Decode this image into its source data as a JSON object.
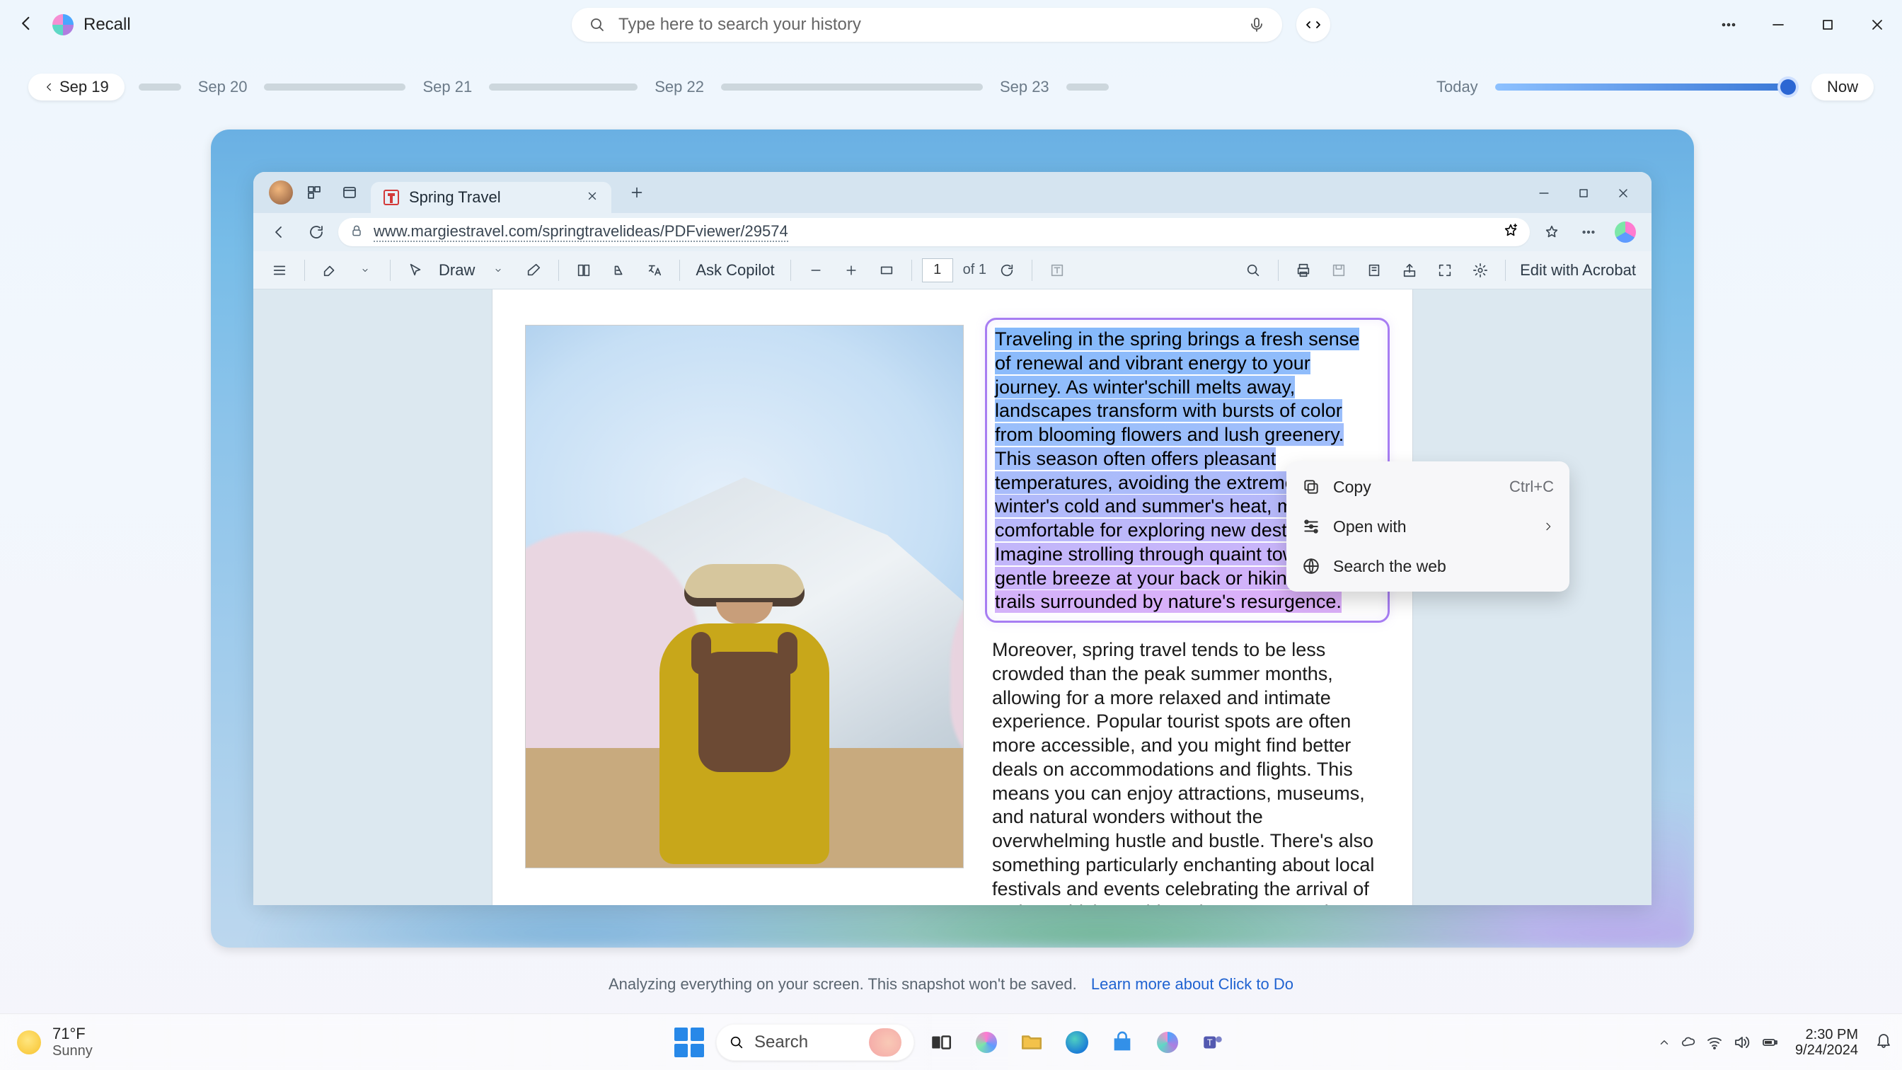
{
  "recall": {
    "app_name": "Recall",
    "search_placeholder": "Type here to search your history",
    "timeline": {
      "start_label": "Sep 19",
      "dates": [
        "Sep 20",
        "Sep 21",
        "Sep 22",
        "Sep 23"
      ],
      "today_label": "Today",
      "now_label": "Now"
    },
    "footer_text": "Analyzing everything on your screen. This snapshot won't be saved.",
    "footer_link": "Learn more about Click to Do"
  },
  "edge": {
    "tab_title": "Spring Travel",
    "url": "www.margiestravel.com/springtravelideas/PDFviewer/29574",
    "pdf_toolbar": {
      "draw_label": "Draw",
      "ask_copilot": "Ask Copilot",
      "page_current": "1",
      "page_total": "of 1",
      "edit_acrobat": "Edit with Acrobat"
    },
    "document": {
      "paragraph1": "Traveling in the spring brings a fresh sense of renewal and vibrant energy to your journey. As winter'schill melts away, landscapes transform with bursts of color from blooming flowers and lush greenery. This season often offers pleasant temperatures, avoiding the extremes of winter's cold and summer's heat, making it comfortable for exploring new destinations. Imagine strolling through quaint towns with a gentle breeze at your back or hiking scenic trails surrounded by nature's resurgence.",
      "paragraph2": "Moreover, spring travel tends to be less crowded than the peak summer months, allowing for a more relaxed and intimate experience. Popular tourist spots are often more accessible, and you might find better deals on accommodations and flights. This means you can enjoy attractions, museums, and natural wonders without the overwhelming hustle and bustle. There's also something particularly enchanting about local festivals and events celebrating the arrival of spring, which provide a deeper connection to the culture and traditions of the place you're visiting."
    }
  },
  "context_menu": {
    "copy_label": "Copy",
    "copy_shortcut": "Ctrl+C",
    "open_with_label": "Open with",
    "search_web_label": "Search the web"
  },
  "taskbar": {
    "weather_temp": "71°F",
    "weather_cond": "Sunny",
    "search_label": "Search",
    "time": "2:30 PM",
    "date": "9/24/2024"
  },
  "colors": {
    "recall_accent": "#2b66d3",
    "highlight_start": "#85b9fb",
    "highlight_end": "#dcb0f9",
    "selection_border": "#a77df2"
  }
}
